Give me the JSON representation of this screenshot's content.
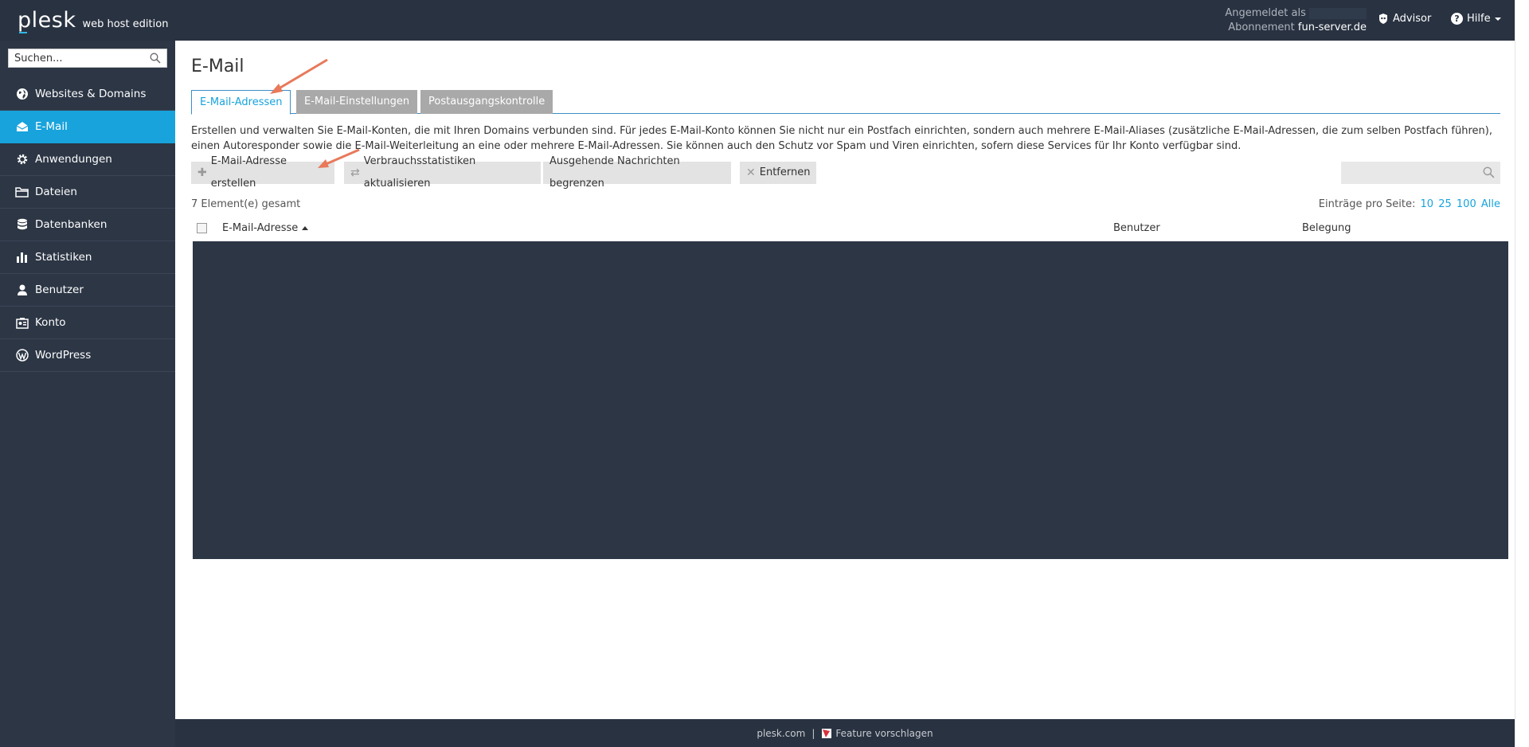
{
  "header": {
    "brand": "plesk",
    "edition": "web host edition",
    "logged_in_label": "Angemeldet als",
    "subscription_label": "Abonnement",
    "subscription_value": "fun-server.de",
    "advisor_label": "Advisor",
    "help_label": "Hilfe"
  },
  "sidebar": {
    "search_placeholder": "Suchen...",
    "items": [
      {
        "label": "Websites & Domains",
        "icon": "globe-icon"
      },
      {
        "label": "E-Mail",
        "icon": "mail-icon",
        "active": true
      },
      {
        "label": "Anwendungen",
        "icon": "gear-icon"
      },
      {
        "label": "Dateien",
        "icon": "folder-icon"
      },
      {
        "label": "Datenbanken",
        "icon": "database-icon"
      },
      {
        "label": "Statistiken",
        "icon": "bar-chart-icon"
      },
      {
        "label": "Benutzer",
        "icon": "user-icon"
      },
      {
        "label": "Konto",
        "icon": "account-icon"
      },
      {
        "label": "WordPress",
        "icon": "wordpress-icon"
      }
    ]
  },
  "main": {
    "title": "E-Mail",
    "tabs": [
      "E-Mail-Adressen",
      "E-Mail-Einstellungen",
      "Postausgangskontrolle"
    ],
    "description": "Erstellen und verwalten Sie E-Mail-Konten, die mit Ihren Domains verbunden sind. Für jedes E-Mail-Konto können Sie nicht nur ein Postfach einrichten, sondern auch mehrere E-Mail-Aliases (zusätzliche E-Mail-Adressen, die zum selben Postfach führen), einen Autoresponder sowie die E-Mail-Weiterleitung an eine oder mehrere E-Mail-Adressen. Sie können auch den Schutz vor Spam und Viren einrichten, sofern diese Services für Ihr Konto verfügbar sind.",
    "toolbar": {
      "create": "E-Mail-Adresse erstellen",
      "update_stats": "Verbrauchsstatistiken aktualisieren",
      "limit_outgoing": "Ausgehende Nachrichten begrenzen",
      "remove": "Entfernen"
    },
    "total": "7 Element(e) gesamt",
    "per_page_label": "Einträge pro Seite:",
    "per_page_options": [
      "10",
      "25",
      "100",
      "Alle"
    ],
    "columns": {
      "email": "E-Mail-Adresse",
      "user": "Benutzer",
      "usage": "Belegung"
    }
  },
  "footer": {
    "link": "plesk.com",
    "separator": "|",
    "feature": "Feature vorschlagen"
  },
  "colors": {
    "topbar": "#293241",
    "sidebar": "#2c3645",
    "accent": "#18a3dc",
    "annotation_arrow": "#e8795a"
  }
}
